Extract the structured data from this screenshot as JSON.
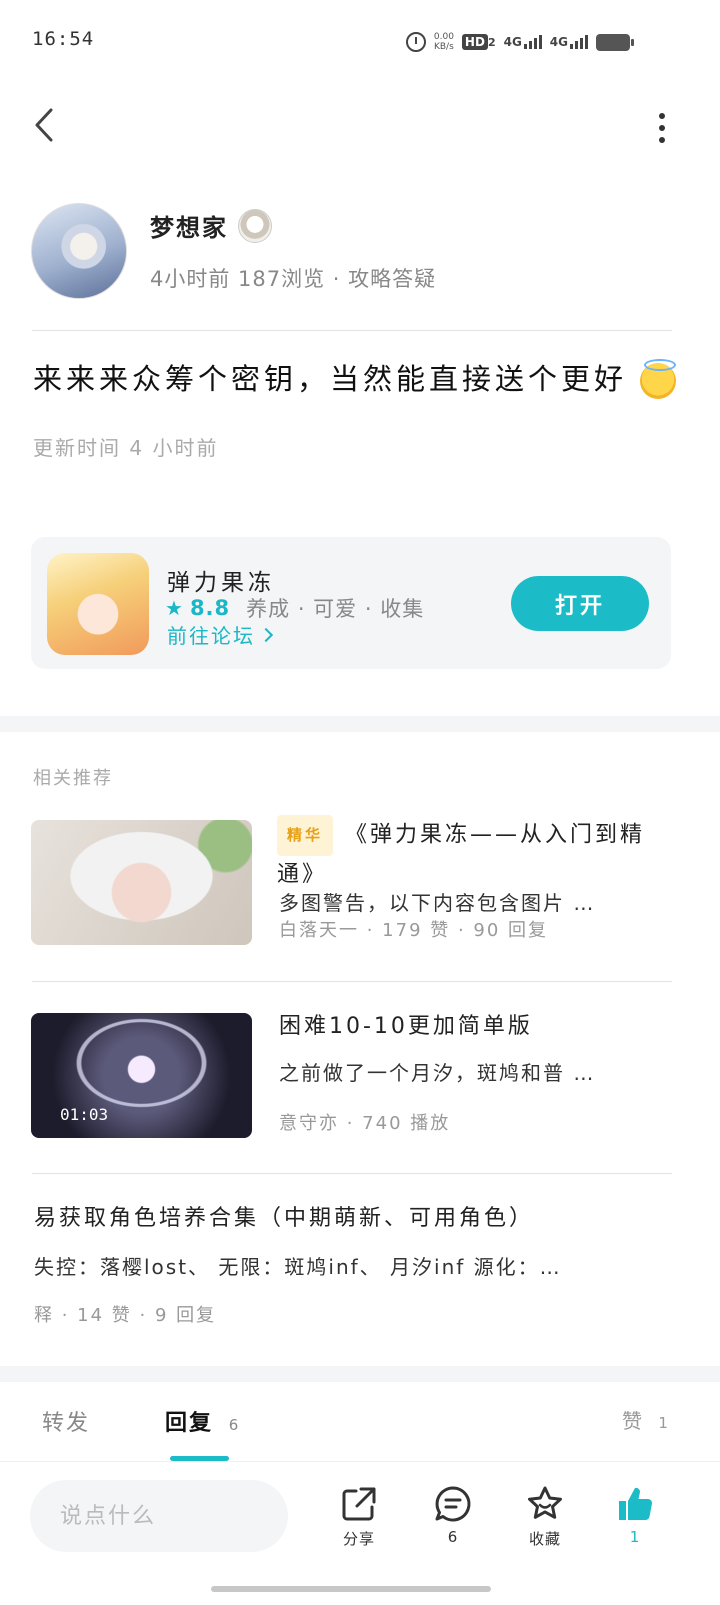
{
  "status_bar": {
    "time": "16:54",
    "speed_value": "0.00",
    "speed_unit": "KB/s",
    "hd_label": "HD",
    "hd_sub": "2",
    "network_1": "4G",
    "network_2": "4G"
  },
  "author": {
    "name": "梦想家",
    "meta": "4小时前 187浏览 · 攻略答疑"
  },
  "post": {
    "title": "来来来众筹个密钥，当然能直接送个更好",
    "update_time": "更新时间 4 小时前"
  },
  "game": {
    "name": "弹力果冻",
    "score": "8.8",
    "tags": "养成 · 可爱 · 收集",
    "forum_link": "前往论坛",
    "open_button": "打开"
  },
  "recommendations": {
    "heading": "相关推荐",
    "items": [
      {
        "tag": "精华",
        "title": "《弹力果冻——从入门到精通》",
        "snippet": "多图警告，以下内容包含图片 …",
        "meta": "白落天一 · 179 赞 · 90 回复"
      },
      {
        "title": "困难10-10更加简单版",
        "snippet": "之前做了一个月汐，斑鸠和普 …",
        "meta": "意守亦 · 740 播放",
        "duration": "01:03"
      },
      {
        "title": "易获取角色培养合集（中期萌新、可用角色）",
        "snippet": "失控：落樱lost、 无限：斑鸠inf、 月汐inf 源化：…",
        "meta": "释 · 14 赞 · 9 回复"
      }
    ]
  },
  "tabs": {
    "forward": "转发",
    "reply": "回复",
    "reply_count": "6",
    "like": "赞",
    "like_count": "1"
  },
  "action_bar": {
    "comment_placeholder": "说点什么",
    "share_label": "分享",
    "comment_count": "6",
    "favorite_label": "收藏",
    "like_count": "1"
  },
  "colors": {
    "accent": "#1bbcc7",
    "tag_bg": "#fff3d6",
    "tag_text": "#e6a118"
  }
}
